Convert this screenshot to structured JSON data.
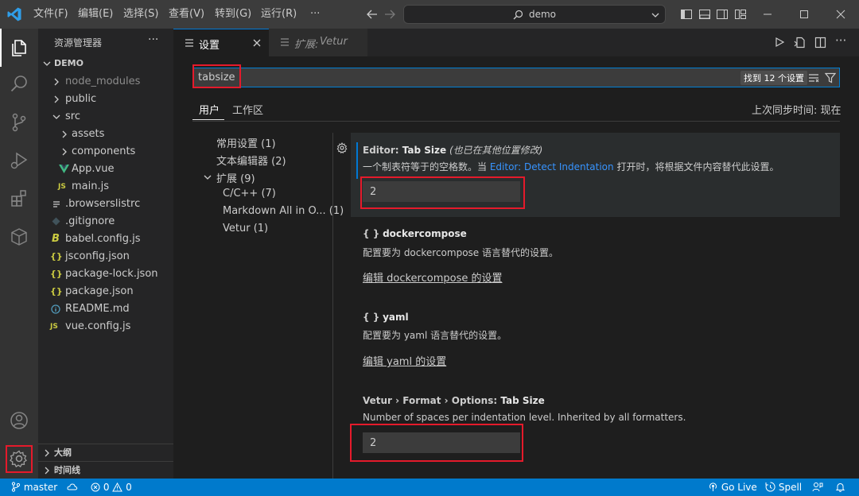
{
  "titlebar": {
    "menus": [
      "文件(F)",
      "编辑(E)",
      "选择(S)",
      "查看(V)",
      "转到(G)",
      "运行(R)",
      "···"
    ],
    "search_text": "demo"
  },
  "sidebar": {
    "title": "资源管理器",
    "more": "···",
    "root": "DEMO",
    "items": [
      {
        "label": "node_modules",
        "depth": 1,
        "kind": "folder"
      },
      {
        "label": "public",
        "depth": 1,
        "kind": "folder"
      },
      {
        "label": "src",
        "depth": 1,
        "kind": "folder-open"
      },
      {
        "label": "assets",
        "depth": 2,
        "kind": "folder"
      },
      {
        "label": "components",
        "depth": 2,
        "kind": "folder"
      },
      {
        "label": "App.vue",
        "depth": 2,
        "kind": "vue"
      },
      {
        "label": "main.js",
        "depth": 2,
        "kind": "js"
      },
      {
        "label": ".browserslistrc",
        "depth": 1,
        "kind": "text"
      },
      {
        "label": ".gitignore",
        "depth": 1,
        "kind": "git"
      },
      {
        "label": "babel.config.js",
        "depth": 1,
        "kind": "babel"
      },
      {
        "label": "jsconfig.json",
        "depth": 1,
        "kind": "json"
      },
      {
        "label": "package-lock.json",
        "depth": 1,
        "kind": "json"
      },
      {
        "label": "package.json",
        "depth": 1,
        "kind": "json"
      },
      {
        "label": "README.md",
        "depth": 1,
        "kind": "info"
      },
      {
        "label": "vue.config.js",
        "depth": 1,
        "kind": "js"
      }
    ],
    "outline": "大纲",
    "timeline": "时间线"
  },
  "tabs": {
    "settings": "设置",
    "vetur_prefix": "扩展:",
    "vetur": "Vetur"
  },
  "settings": {
    "search_value": "tabsize",
    "found": "找到 12 个设置",
    "tab_user": "用户",
    "tab_workspace": "工作区",
    "sync": "上次同步时间: 现在",
    "toc": [
      {
        "label": "常用设置",
        "count": "(1)"
      },
      {
        "label": "文本编辑器",
        "count": "(2)"
      },
      {
        "label": "扩展",
        "count": "(9)"
      },
      {
        "label": "C/C++",
        "count": "(7)"
      },
      {
        "label": "Markdown All in O...",
        "count": "(1)"
      },
      {
        "label": "Vetur",
        "count": "(1)"
      }
    ],
    "editor_tabsize": {
      "category": "Editor: ",
      "name": "Tab Size",
      "modified": "(也已在其他位置修改)",
      "desc_before": "一个制表符等于的空格数。当",
      "desc_link": "Editor: Detect Indentation",
      "desc_after": "打开时，将根据文件内容替代此设置。",
      "value": "2"
    },
    "dockercompose": {
      "braces": "{ }",
      "name": "dockercompose",
      "desc": "配置要为 dockercompose 语言替代的设置。",
      "link": "编辑 dockercompose 的设置"
    },
    "yaml": {
      "braces": "{ }",
      "name": "yaml",
      "desc": "配置要为 yaml 语言替代的设置。",
      "link": "编辑 yaml 的设置"
    },
    "vetur_tabsize": {
      "category": "Vetur › Format › Options: ",
      "name": "Tab Size",
      "desc": "Number of spaces per indentation level. Inherited by all formatters.",
      "value": "2"
    }
  },
  "statusbar": {
    "branch": "master",
    "errors": "0",
    "warnings": "0",
    "golive": "Go Live",
    "spell": "Spell"
  }
}
